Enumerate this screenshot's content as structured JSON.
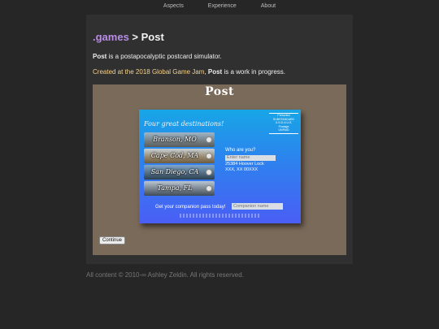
{
  "nav": {
    "items": [
      {
        "label": "Aspects"
      },
      {
        "label": "Experience"
      },
      {
        "label": "About"
      }
    ]
  },
  "header": {
    "site": ".games",
    "separator": " > ",
    "page": "Post"
  },
  "intro": {
    "name": "Post",
    "text": " is a postapocalyptic postcard simulator."
  },
  "status": {
    "gamejam": "Created at the 2018 Global Game Jam",
    "mid": ", ",
    "name": "Post",
    "end": " is a work in progress."
  },
  "game": {
    "title": "Post",
    "postcard": {
      "stamp_lines": [
        "Presorted",
        "SUBSTANDARD",
        "U.N.D.A.U.S.",
        "Postage",
        "UNPAID"
      ],
      "headline": "Four great destinations!",
      "destinations": [
        {
          "label": "Branson, MO"
        },
        {
          "label": "Cape Cod, MA"
        },
        {
          "label": "San Diego, CA"
        },
        {
          "label": "Tampa, FL"
        }
      ],
      "who_label": "Who are you?",
      "name_placeholder": "Enter name",
      "address_lines": [
        "25384 Hoover Lock",
        "XXX, XX 00XXX"
      ],
      "companion_label": "Get your companion pass today!",
      "companion_placeholder": "Companion name"
    },
    "continue_label": "Continue"
  },
  "footer": {
    "text": "All content © 2010-∞ Ashley Zeldin. All rights reserved."
  },
  "colors": {
    "background": "#262626",
    "panel": "#303030",
    "accent_purple": "#b98ce6",
    "accent_gold": "#f5d28a",
    "game_bg": "#7a6a5a",
    "postcard_top": "#17a6e6",
    "postcard_bottom": "#4a5ef5"
  }
}
